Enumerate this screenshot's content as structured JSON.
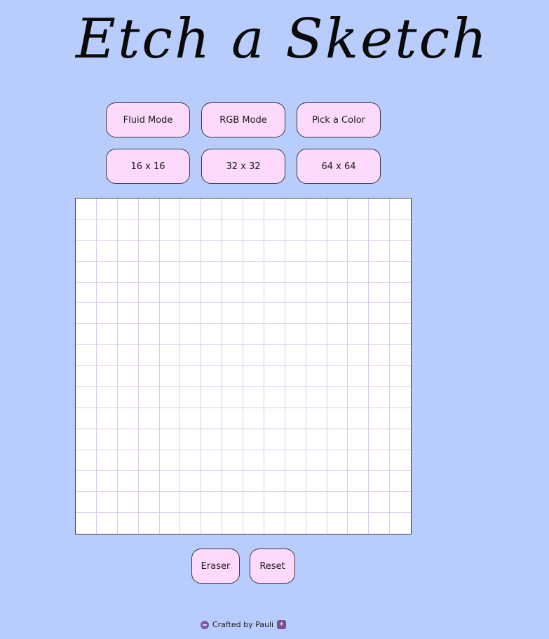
{
  "title": "Etch a Sketch",
  "modes": {
    "fluid": "Fluid Mode",
    "rgb": "RGB Mode",
    "pick": "Pick a Color"
  },
  "sizes": {
    "s16": "16 x 16",
    "s32": "32 x 32",
    "s64": "64 x 64"
  },
  "grid": {
    "rows": 16,
    "cols": 16,
    "cell_color": "#ffffff",
    "line_color": "#dccbe8"
  },
  "actions": {
    "eraser": "Eraser",
    "reset": "Reset"
  },
  "footer": {
    "text": "Crafted by Pauli"
  },
  "colors": {
    "background": "#b9cdfd",
    "button": "#fdd9fb"
  }
}
